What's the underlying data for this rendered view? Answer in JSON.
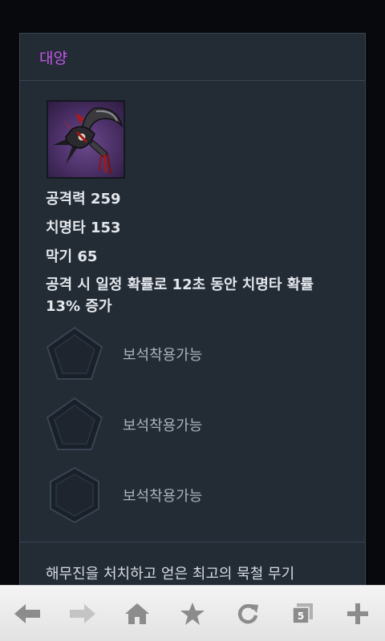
{
  "item": {
    "name": "대양",
    "name_color": "#c357e8",
    "icon": "weapon-icon",
    "stats": {
      "attack": "공격력 259",
      "crit": "치명타 153",
      "block": "막기 65"
    },
    "effect": "공격 시 일정 확률로 12초 동안 치명타 확률 13% 증가",
    "sockets": [
      {
        "shape": "pentagon",
        "label": "보석착용가능"
      },
      {
        "shape": "pentagon",
        "label": "보석착용가능"
      },
      {
        "shape": "hexagon",
        "label": "보석착용가능"
      }
    ],
    "description": "해무진을 처치하고 얻은 최고의 묵철 무기"
  },
  "toolbar": {
    "buttons": [
      "back-icon",
      "forward-icon",
      "home-icon",
      "bookmark-star-icon",
      "refresh-icon",
      "tabs-icon",
      "new-tab-plus-icon"
    ],
    "tab_count": "5"
  }
}
